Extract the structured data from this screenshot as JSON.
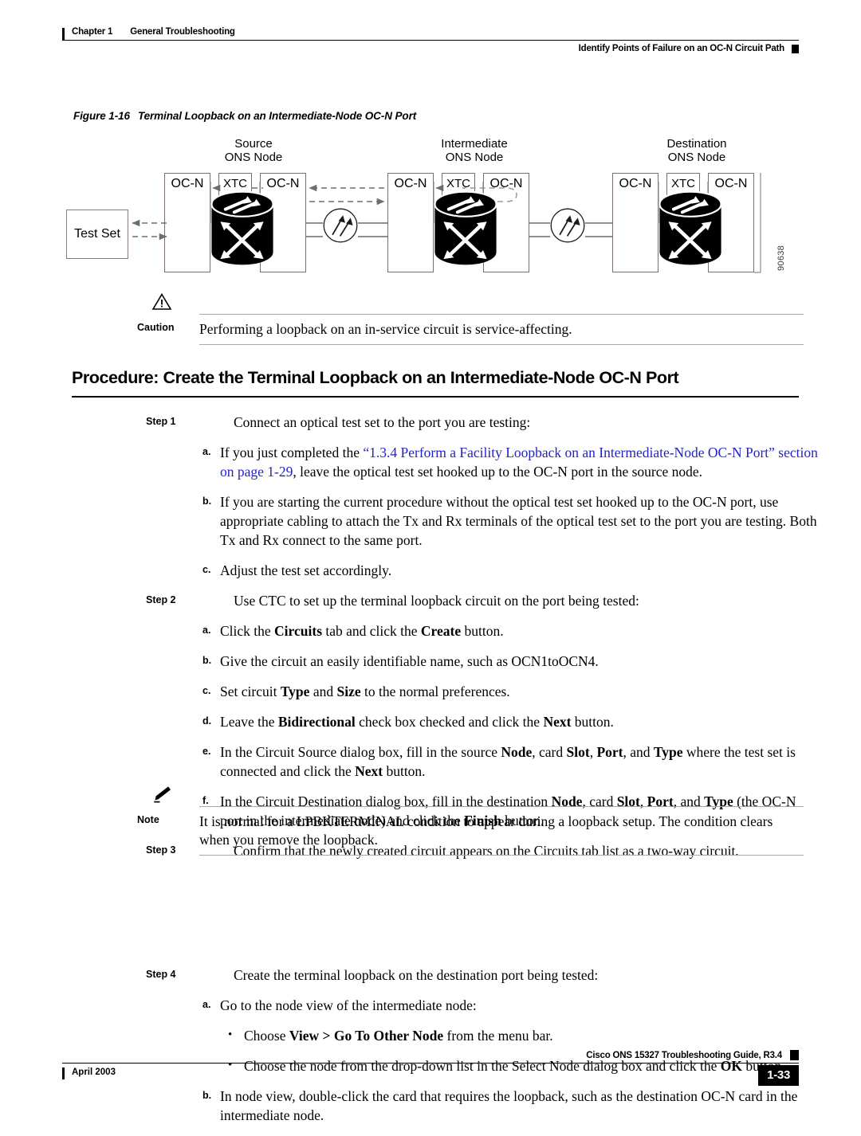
{
  "header": {
    "chapter": "Chapter 1",
    "chapter_title": "General Troubleshooting",
    "running_head": "Identify Points of Failure on an OC-N Circuit Path"
  },
  "figure": {
    "number": "Figure 1-16",
    "title": "Terminal Loopback on an Intermediate-Node OC-N Port",
    "art_id": "90638",
    "test_set_label": "Test Set",
    "nodes": [
      {
        "title": "Source\nONS Node",
        "cards": [
          "OC-N",
          "XTC",
          "OC-N"
        ]
      },
      {
        "title": "Intermediate\nONS Node",
        "cards": [
          "OC-N",
          "XTC",
          "OC-N"
        ]
      },
      {
        "title": "Destination\nONS Node",
        "cards": [
          "OC-N",
          "XTC",
          "OC-N"
        ]
      }
    ]
  },
  "caution": {
    "label": "Caution",
    "icon": "warning-triangle-icon",
    "text": "Performing a loopback on an in-service circuit is service-affecting."
  },
  "note": {
    "label": "Note",
    "icon": "pencil-icon",
    "text": "It is normal for a LPBKTERMINAL condition to appear during a loopback setup. The condition clears when you remove the loopback."
  },
  "procedure": {
    "heading": "Procedure: Create the Terminal Loopback on an Intermediate-Node OC-N Port"
  },
  "steps": [
    {
      "label": "Step 1",
      "text": "Connect an optical test set to the port you are testing:",
      "substeps": [
        {
          "marker": "a.",
          "parts": [
            {
              "t": "If you just completed the ",
              "s": "normal"
            },
            {
              "t": "“1.3.4 Perform a Facility Loopback on an Intermediate-Node OC-N Port” section on page 1-29",
              "s": "xref"
            },
            {
              "t": ", leave the optical test set hooked up to the OC-N port in the source node.",
              "s": "normal"
            }
          ]
        },
        {
          "marker": "b.",
          "parts": [
            {
              "t": "If you are starting the current procedure without the optical test set hooked up to the OC-N port, use appropriate cabling to attach the Tx and Rx terminals of the optical test set to the port you are testing. Both Tx and Rx connect to the same port.",
              "s": "normal"
            }
          ]
        },
        {
          "marker": "c.",
          "parts": [
            {
              "t": "Adjust the test set accordingly.",
              "s": "normal"
            }
          ]
        }
      ]
    },
    {
      "label": "Step 2",
      "text": "Use CTC to set up the terminal loopback circuit on the port being tested:",
      "substeps": [
        {
          "marker": "a.",
          "parts": [
            {
              "t": "Click the ",
              "s": "normal"
            },
            {
              "t": "Circuits",
              "s": "bold"
            },
            {
              "t": " tab and click the ",
              "s": "normal"
            },
            {
              "t": "Create",
              "s": "bold"
            },
            {
              "t": " button.",
              "s": "normal"
            }
          ]
        },
        {
          "marker": "b.",
          "parts": [
            {
              "t": "Give the circuit an easily identifiable name, such as OCN1toOCN4.",
              "s": "normal"
            }
          ]
        },
        {
          "marker": "c.",
          "parts": [
            {
              "t": "Set circuit ",
              "s": "normal"
            },
            {
              "t": "Type",
              "s": "bold"
            },
            {
              "t": " and ",
              "s": "normal"
            },
            {
              "t": "Size",
              "s": "bold"
            },
            {
              "t": " to the normal preferences.",
              "s": "normal"
            }
          ]
        },
        {
          "marker": "d.",
          "parts": [
            {
              "t": "Leave the ",
              "s": "normal"
            },
            {
              "t": "Bidirectional",
              "s": "bold"
            },
            {
              "t": " check box checked and click the ",
              "s": "normal"
            },
            {
              "t": "Next",
              "s": "bold"
            },
            {
              "t": " button.",
              "s": "normal"
            }
          ]
        },
        {
          "marker": "e.",
          "parts": [
            {
              "t": "In the Circuit Source dialog box, fill in the source ",
              "s": "normal"
            },
            {
              "t": "Node",
              "s": "bold"
            },
            {
              "t": ", card ",
              "s": "normal"
            },
            {
              "t": "Slot",
              "s": "bold"
            },
            {
              "t": ", ",
              "s": "normal"
            },
            {
              "t": "Port",
              "s": "bold"
            },
            {
              "t": ", and ",
              "s": "normal"
            },
            {
              "t": "Type",
              "s": "bold"
            },
            {
              "t": " where the test set is connected and click the ",
              "s": "normal"
            },
            {
              "t": "Next",
              "s": "bold"
            },
            {
              "t": " button.",
              "s": "normal"
            }
          ]
        },
        {
          "marker": "f.",
          "parts": [
            {
              "t": "In the Circuit Destination dialog box, fill in the destination ",
              "s": "normal"
            },
            {
              "t": "Node",
              "s": "bold"
            },
            {
              "t": ", card ",
              "s": "normal"
            },
            {
              "t": "Slot",
              "s": "bold"
            },
            {
              "t": ", ",
              "s": "normal"
            },
            {
              "t": "Port",
              "s": "bold"
            },
            {
              "t": ", and ",
              "s": "normal"
            },
            {
              "t": "Type",
              "s": "bold"
            },
            {
              "t": " (the OC-N port in the intermediate node) and click the ",
              "s": "normal"
            },
            {
              "t": "Finish",
              "s": "bold"
            },
            {
              "t": " button.",
              "s": "normal"
            }
          ]
        }
      ]
    },
    {
      "label": "Step 3",
      "text": "Confirm that the newly created circuit appears on the Circuits tab list as a two-way circuit.",
      "substeps": []
    },
    {
      "label": "Step 4",
      "text": "Create the terminal loopback on the destination port being tested:",
      "substeps": [
        {
          "marker": "a.",
          "parts": [
            {
              "t": "Go to the node view of the intermediate node:",
              "s": "normal"
            }
          ],
          "bullets": [
            {
              "parts": [
                {
                  "t": "Choose ",
                  "s": "normal"
                },
                {
                  "t": "View > Go To Other Node",
                  "s": "bold"
                },
                {
                  "t": " from the menu bar.",
                  "s": "normal"
                }
              ]
            },
            {
              "parts": [
                {
                  "t": "Choose the node from the drop-down list in the Select Node dialog box and click the ",
                  "s": "normal"
                },
                {
                  "t": "OK",
                  "s": "bold"
                },
                {
                  "t": " button.",
                  "s": "normal"
                }
              ]
            }
          ]
        },
        {
          "marker": "b.",
          "parts": [
            {
              "t": "In node view, double-click the card that requires the loopback, such as the destination OC-N card in the intermediate node.",
              "s": "normal"
            }
          ]
        }
      ]
    }
  ],
  "footer": {
    "guide_title": "Cisco ONS 15327 Troubleshooting Guide, R3.4",
    "date": "April 2003",
    "page_number": "1-33"
  },
  "colors": {
    "xref_blue": "#2222cc",
    "rule_gray": "#a9a9a9",
    "card_border": "#7a6e72",
    "arrow_gray": "#6e6e6e"
  }
}
